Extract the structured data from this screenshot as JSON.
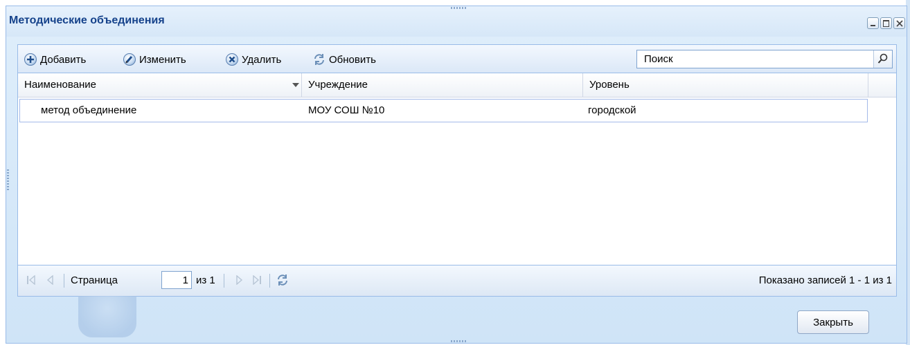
{
  "window": {
    "title": "Методические объединения",
    "controls": {
      "minimize_icon": "minimize-icon",
      "maximize_icon": "maximize-icon",
      "close_icon": "close-icon"
    }
  },
  "toolbar": {
    "add_label": "Добавить",
    "edit_label": "Изменить",
    "delete_label": "Удалить",
    "refresh_label": "Обновить",
    "search_placeholder": "Поиск"
  },
  "grid": {
    "columns": [
      "Наименование",
      "Учреждение",
      "Уровень"
    ],
    "rows": [
      [
        "метод объединение",
        "МОУ СОШ №10",
        "городской"
      ]
    ]
  },
  "pager": {
    "page_label": "Страница",
    "page_value": "1",
    "of_label": "из 1",
    "summary": "Показано записей 1 - 1 из 1"
  },
  "footer": {
    "close_label": "Закрыть"
  },
  "colors": {
    "accent": "#15428b",
    "border": "#99bbe8",
    "window_bg": "#cfe4f7"
  }
}
